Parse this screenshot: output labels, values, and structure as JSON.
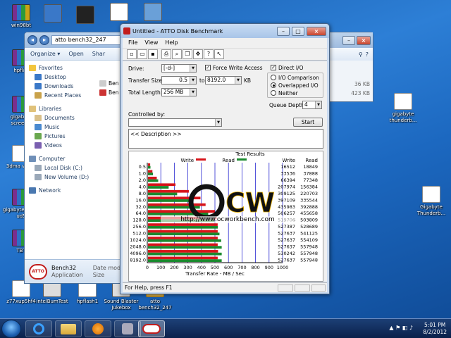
{
  "desktop_icons": [
    {
      "label": "win98bt",
      "kind": "rar"
    },
    {
      "label": "hpflas",
      "kind": "rar"
    },
    {
      "label": "gigabyte screen s",
      "kind": "rar"
    },
    {
      "label": "3dma vanta",
      "kind": "doc"
    },
    {
      "label": "gigabyte z77x-ud5",
      "kind": "rar"
    },
    {
      "label": "TBT",
      "kind": "rar"
    },
    {
      "label": "z77xup5hf4",
      "kind": "doc"
    },
    {
      "label": "intelBumTest",
      "kind": "exe"
    },
    {
      "label": "hpflash1",
      "kind": "doc"
    },
    {
      "label": "Sound Blaster Jukebox",
      "kind": "exe"
    },
    {
      "label": "atto bench32_247",
      "kind": "folder"
    },
    {
      "label": "gigabyte thunderb...",
      "kind": "doc"
    },
    {
      "label": "Gigabyte Thunderb...",
      "kind": "doc"
    }
  ],
  "explorer": {
    "address": "atto bench32_247",
    "toolbar": [
      "Organize ▾",
      "Open",
      "Shar"
    ],
    "nav": {
      "favorites": "Favorites",
      "fav_items": [
        "Desktop",
        "Downloads",
        "Recent Places"
      ],
      "libraries": "Libraries",
      "lib_items": [
        "Documents",
        "Music",
        "Pictures",
        "Videos"
      ],
      "computer": "Computer",
      "comp_items": [
        "Local Disk (C:)",
        "New Volume (D:)"
      ],
      "network": "Network"
    },
    "files": [
      "Ben",
      "Ben"
    ],
    "sizes": [
      "36 KB",
      "423 KB"
    ],
    "footer_name": "Bench32",
    "footer_type": "Application",
    "footer_mod": "Date modifie",
    "footer_size": "Size"
  },
  "atto": {
    "title": "Untitled - ATTO Disk Benchmark",
    "menu": [
      "File",
      "View",
      "Help"
    ],
    "drive_label": "Drive:",
    "drive_value": "[-d-]",
    "force_write_label": "Force Write Access",
    "direct_io_label": "Direct I/O",
    "transfer_size_label": "Transfer Size:",
    "ts_from": "0.5",
    "to_label": "to",
    "ts_to": "8192.0",
    "kb_label": "KB",
    "total_length_label": "Total Length:",
    "total_length": "256 MB",
    "io_comparison": "I/O Comparison",
    "overlapped_io": "Overlapped I/O",
    "neither": "Neither",
    "queue_depth_label": "Queue Depth:",
    "queue_depth": "4",
    "controlled_by_label": "Controlled by:",
    "start_label": "Start",
    "description": "<< Description >>",
    "status": "For Help, press F1",
    "watermark": "http://www.ocworkbench.com"
  },
  "chart_data": {
    "type": "bar",
    "title": "Test Results",
    "legend": [
      "Write",
      "Read"
    ],
    "colors": {
      "write": "#d7141a",
      "read": "#1a8a2e"
    },
    "categories": [
      "0.5",
      "1.0",
      "2.0",
      "4.0",
      "8.0",
      "16.0",
      "32.0",
      "64.0",
      "128.0",
      "256.0",
      "512.0",
      "1024.0",
      "2048.0",
      "4096.0",
      "8192.0"
    ],
    "series": [
      {
        "name": "Write",
        "values": [
          16512,
          33536,
          66394,
          207974,
          309125,
          397109,
          435983,
          506257,
          519706,
          527387,
          527637,
          527637,
          527637,
          530242,
          527637
        ]
      },
      {
        "name": "Read",
        "values": [
          18849,
          37888,
          77348,
          156384,
          220703,
          335544,
          392888,
          455658,
          503809,
          528689,
          541125,
          554109,
          557948,
          557948,
          557948
        ]
      }
    ],
    "column_headers": [
      "Write",
      "Read"
    ],
    "xlabel": "Transfer Rate - MB / Sec",
    "xticks": [
      0,
      100,
      200,
      300,
      400,
      500,
      600,
      700,
      800,
      900,
      1000
    ],
    "xlim": [
      0,
      1000
    ]
  },
  "taskbar": {
    "time": "5:01 PM",
    "date": "8/2/2012"
  }
}
